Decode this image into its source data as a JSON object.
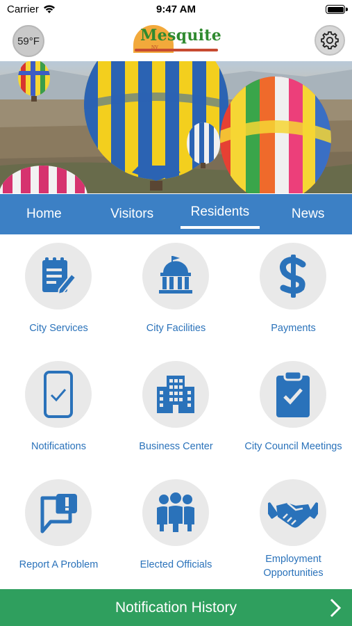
{
  "status_bar": {
    "carrier": "Carrier",
    "time": "9:47 AM"
  },
  "header": {
    "temperature": "59°F",
    "logo_text": "Mesquite",
    "logo_sub": "NV"
  },
  "nav": {
    "tabs": [
      {
        "label": "Home",
        "active": false
      },
      {
        "label": "Visitors",
        "active": false
      },
      {
        "label": "Residents",
        "active": true
      },
      {
        "label": "News",
        "active": false
      }
    ]
  },
  "grid": {
    "items": [
      {
        "label": "City Services",
        "icon": "document-edit-icon"
      },
      {
        "label": "City Facilities",
        "icon": "government-building-icon"
      },
      {
        "label": "Payments",
        "icon": "dollar-sign-icon"
      },
      {
        "label": "Notifications",
        "icon": "phone-check-icon"
      },
      {
        "label": "Business Center",
        "icon": "office-building-icon"
      },
      {
        "label": "City Council Meetings",
        "icon": "clipboard-check-icon"
      },
      {
        "label": "Report A Problem",
        "icon": "report-problem-icon"
      },
      {
        "label": "Elected Officials",
        "icon": "people-group-icon"
      },
      {
        "label": "Employment Opportunities",
        "icon": "handshake-icon"
      }
    ]
  },
  "footer": {
    "label": "Notification History"
  },
  "colors": {
    "nav_blue": "#3c80c5",
    "icon_blue": "#2a72ba",
    "footer_green": "#2f9f5e"
  }
}
